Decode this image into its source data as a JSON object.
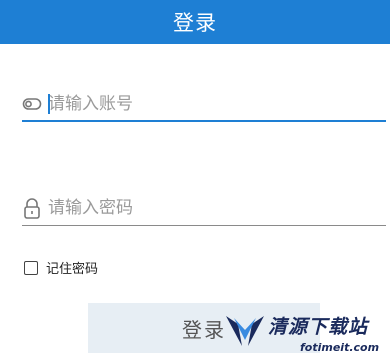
{
  "header": {
    "title": "登录"
  },
  "account": {
    "placeholder": "请输入账号",
    "value": ""
  },
  "password": {
    "placeholder": "请输入密码",
    "value": ""
  },
  "remember": {
    "label": "记住密码",
    "checked": false
  },
  "login_button": {
    "label": "登录"
  },
  "watermark": {
    "title": "清源下载站",
    "url": "fotimeit.com"
  },
  "colors": {
    "accent": "#1e7fd4",
    "header_bg": "#1e7fd4",
    "button_bg": "#e7eef4"
  }
}
